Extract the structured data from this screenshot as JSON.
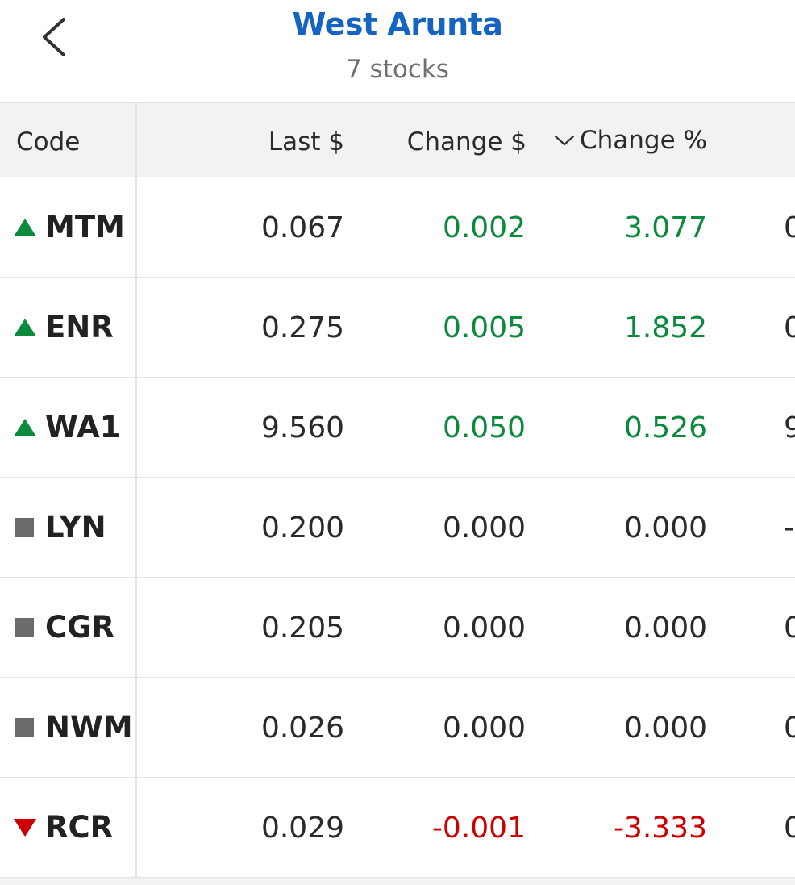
{
  "header": {
    "back_icon": "chevron-left-icon",
    "title": "West Arunta",
    "subtitle": "7 stocks"
  },
  "table": {
    "columns": {
      "code": "Code",
      "last": "Last $",
      "change": "Change $",
      "change_pct": "Change %",
      "sort_icon": "chevron-down-icon"
    },
    "rows": [
      {
        "code": "MTM",
        "trend": "up",
        "last": "0.067",
        "change": "0.002",
        "change_pct": "3.077",
        "extra": "0"
      },
      {
        "code": "ENR",
        "trend": "up",
        "last": "0.275",
        "change": "0.005",
        "change_pct": "1.852",
        "extra": "0"
      },
      {
        "code": "WA1",
        "trend": "up",
        "last": "9.560",
        "change": "0.050",
        "change_pct": "0.526",
        "extra": "9"
      },
      {
        "code": "LYN",
        "trend": "flat",
        "last": "0.200",
        "change": "0.000",
        "change_pct": "0.000",
        "extra": "-"
      },
      {
        "code": "CGR",
        "trend": "flat",
        "last": "0.205",
        "change": "0.000",
        "change_pct": "0.000",
        "extra": "0"
      },
      {
        "code": "NWM",
        "trend": "flat",
        "last": "0.026",
        "change": "0.000",
        "change_pct": "0.000",
        "extra": "0"
      },
      {
        "code": "RCR",
        "trend": "down",
        "last": "0.029",
        "change": "-0.001",
        "change_pct": "-3.333",
        "extra": "0"
      }
    ]
  },
  "colors": {
    "title": "#1565c0",
    "up": "#0b8a3e",
    "down": "#cc0000",
    "flat_indicator": "#6b6b6b"
  }
}
